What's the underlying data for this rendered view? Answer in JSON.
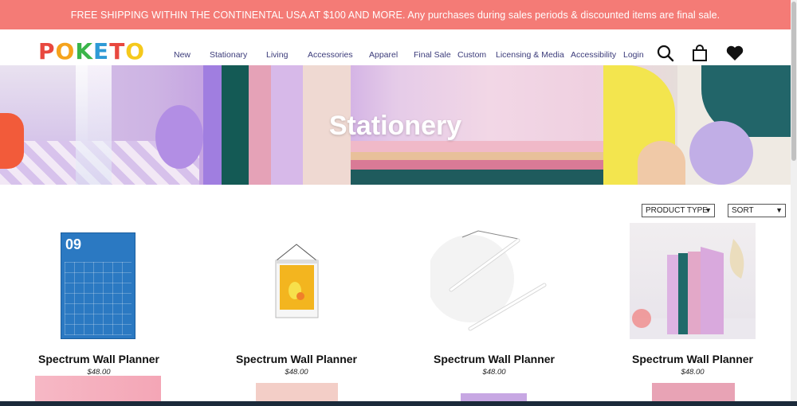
{
  "promo_bar": {
    "text": "FREE SHIPPING WITHIN THE CONTINENTAL USA AT $100 AND MORE. Any purchases during sales periods & discounted items are final sale."
  },
  "header": {
    "logo_text": "POKETO",
    "logo_letter_colors": [
      "#e8483f",
      "#f5a31c",
      "#3ab54a",
      "#2e9ad6",
      "#e8483f",
      "#f5c91c"
    ],
    "nav": [
      {
        "label": "New"
      },
      {
        "label": "Stationary"
      },
      {
        "label": "Living"
      },
      {
        "label": "Accessories"
      },
      {
        "label": "Apparel"
      },
      {
        "label": "Final Sale"
      },
      {
        "label": "Custom"
      },
      {
        "label": "Licensing & Media"
      },
      {
        "label": "Accessibility"
      },
      {
        "label": "Login"
      }
    ],
    "icons": [
      "search-icon",
      "shopping-bag-icon",
      "heart-icon"
    ]
  },
  "banner": {
    "title": "Stationery"
  },
  "filters": {
    "product_type": "PRODUCT TYPE",
    "sort": "SORT"
  },
  "products": [
    {
      "name": "Spectrum Wall Planner",
      "price": "$48.00",
      "planner_number": "09"
    },
    {
      "name": "Spectrum Wall Planner",
      "price": "$48.00"
    },
    {
      "name": "Spectrum Wall Planner",
      "price": "$48.00"
    },
    {
      "name": "Spectrum Wall Planner",
      "price": "$48.00"
    }
  ],
  "colors": {
    "promo_bg": "#f47b76",
    "nav_text": "#3b3b7a"
  }
}
